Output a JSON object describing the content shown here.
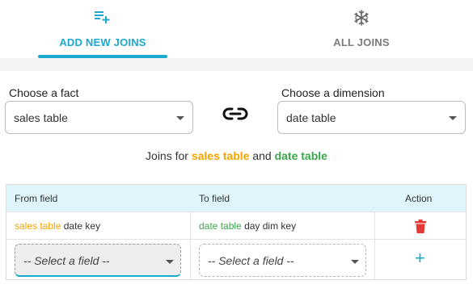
{
  "tabs": [
    {
      "label": "ADD NEW JOINS",
      "icon": "playlist-add-icon",
      "active": true
    },
    {
      "label": "ALL JOINS",
      "icon": "snowflake-icon",
      "active": false
    }
  ],
  "fact": {
    "label": "Choose a fact",
    "value": "sales table"
  },
  "dimension": {
    "label": "Choose a dimension",
    "value": "date table"
  },
  "caption": {
    "prefix": "Joins for",
    "fact": "sales table",
    "conj": "and",
    "dimension": "date table"
  },
  "table": {
    "headers": [
      "From field",
      "To field",
      "Action"
    ],
    "rows": [
      {
        "from_table": "sales table",
        "from_field": "date key",
        "to_table": "date table",
        "to_field": "day dim key",
        "action_icon": "trash-icon"
      }
    ],
    "new_row": {
      "from_placeholder": "-- Select a field --",
      "to_placeholder": "-- Select a field --",
      "action_icon": "plus-icon"
    }
  },
  "colors": {
    "accent": "#1ba9d0",
    "fact": "#f5a400",
    "dimension": "#3aa84a",
    "delete": "#e53935",
    "header_bg": "#e0f4fc"
  }
}
